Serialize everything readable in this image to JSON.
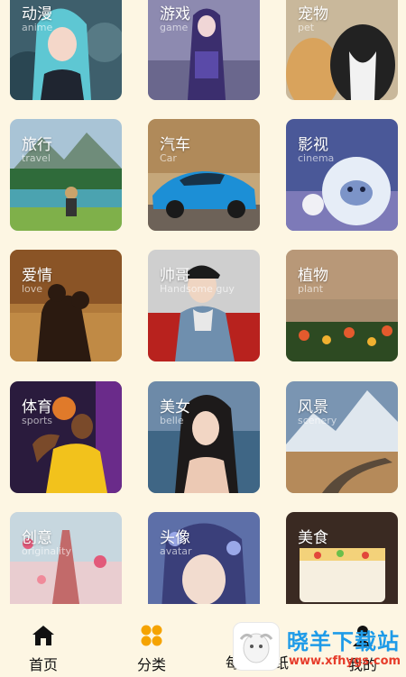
{
  "categories": [
    {
      "title": "动漫",
      "subtitle": "anime",
      "scene": "anime-girl-blue-hair"
    },
    {
      "title": "游戏",
      "subtitle": "game",
      "scene": "game-character-purple"
    },
    {
      "title": "宠物",
      "subtitle": "pet",
      "scene": "cats"
    },
    {
      "title": "旅行",
      "subtitle": "travel",
      "scene": "mountain-lake"
    },
    {
      "title": "汽车",
      "subtitle": "Car",
      "scene": "blue-sports-car"
    },
    {
      "title": "影视",
      "subtitle": "cinema",
      "scene": "yeti-movie"
    },
    {
      "title": "爱情",
      "subtitle": "love",
      "scene": "couple-silhouette-sunset"
    },
    {
      "title": "帅哥",
      "subtitle": "Handsome guy",
      "scene": "young-man-denim"
    },
    {
      "title": "植物",
      "subtitle": "plant",
      "scene": "flowers-field"
    },
    {
      "title": "体育",
      "subtitle": "sports",
      "scene": "basketball-player"
    },
    {
      "title": "美女",
      "subtitle": "belle",
      "scene": "woman-beach"
    },
    {
      "title": "风景",
      "subtitle": "scenery",
      "scene": "mountain-road"
    },
    {
      "title": "创意",
      "subtitle": "originality",
      "scene": "eiffel-tower-balloons"
    },
    {
      "title": "头像",
      "subtitle": "avatar",
      "scene": "anime-portrait-flowers"
    },
    {
      "title": "美食",
      "subtitle": "",
      "scene": "cake-food"
    }
  ],
  "tabbar": {
    "home": {
      "label": "首页",
      "icon": "home-icon"
    },
    "category": {
      "label": "分类",
      "icon": "category-grid-icon",
      "active_color": "#f5a300"
    },
    "wallpaper": {
      "label_partial_left": "每",
      "label_partial_right": "纸"
    },
    "mine": {
      "label": "我的",
      "icon": "user-icon"
    }
  },
  "watermark": {
    "title": "晓羊下载站",
    "url": "www.xfhygs.com"
  }
}
